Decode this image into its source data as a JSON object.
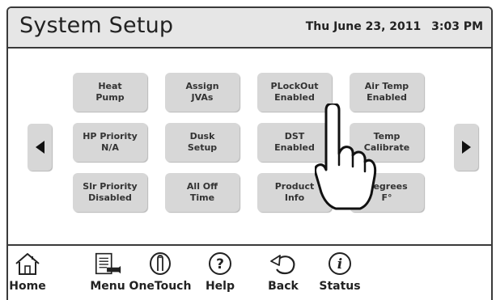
{
  "header": {
    "title": "System Setup",
    "date": "Thu June 23, 2011",
    "time": "3:03 PM"
  },
  "grid": [
    {
      "line1": "Heat",
      "line2": "Pump"
    },
    {
      "line1": "Assign",
      "line2": "JVAs"
    },
    {
      "line1": "PLockOut",
      "line2": "Enabled"
    },
    {
      "line1": "Air Temp",
      "line2": "Enabled"
    },
    {
      "line1": "HP Priority",
      "line2": "N/A"
    },
    {
      "line1": "Dusk",
      "line2": "Setup"
    },
    {
      "line1": "DST",
      "line2": "Enabled"
    },
    {
      "line1": "Temp",
      "line2": "Calibrate"
    },
    {
      "line1": "Slr Priority",
      "line2": "Disabled"
    },
    {
      "line1": "All Off",
      "line2": "Time"
    },
    {
      "line1": "Product",
      "line2": "Info"
    },
    {
      "line1": "Degrees",
      "line2": "F°"
    }
  ],
  "nav": {
    "prev_icon": "left-triangle-icon",
    "next_icon": "right-triangle-icon"
  },
  "toolbar": [
    {
      "label": "Home",
      "icon": "house-icon"
    },
    {
      "label": "Menu",
      "icon": "menu-document-icon"
    },
    {
      "label": "OneTouch",
      "icon": "touch-finger-icon"
    },
    {
      "label": "Help",
      "icon": "question-icon"
    },
    {
      "label": "Back",
      "icon": "back-arrow-icon"
    },
    {
      "label": "Status",
      "icon": "info-icon"
    }
  ],
  "colors": {
    "header_bg": "#e6e6e6",
    "button_bg": "#d7d7d7",
    "border": "#3a3a3a"
  }
}
